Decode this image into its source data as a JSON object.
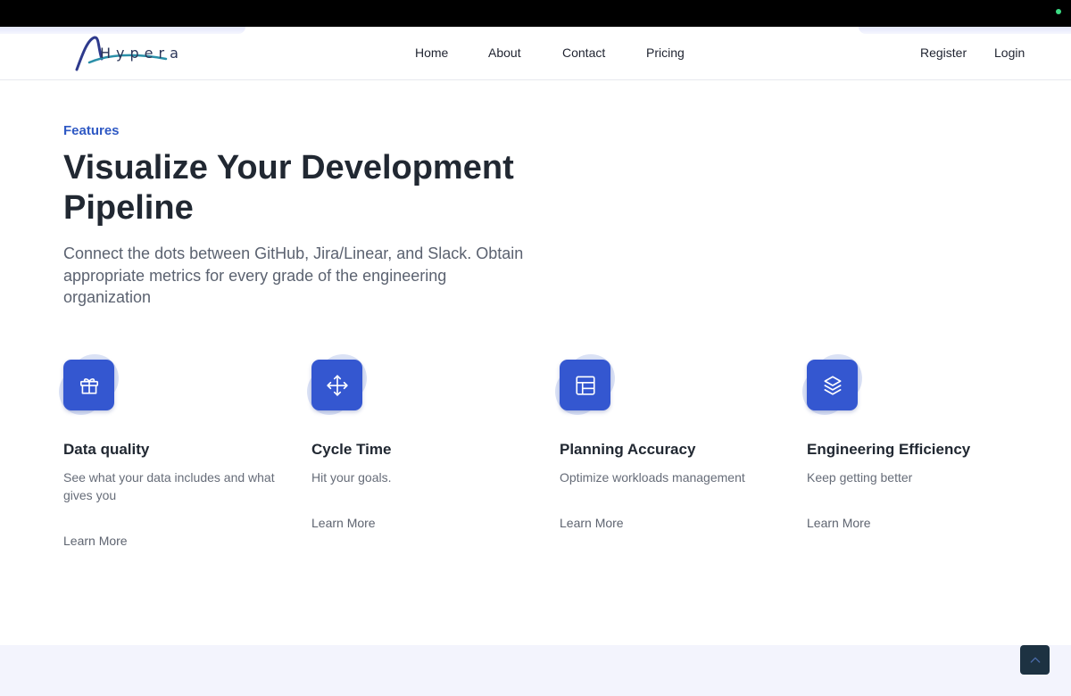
{
  "brand": {
    "name": "Hypera"
  },
  "nav": {
    "links": [
      "Home",
      "About",
      "Contact",
      "Pricing"
    ],
    "register": "Register",
    "login": "Login"
  },
  "hero": {
    "eyebrow": "Features",
    "title": "Visualize Your Development Pipeline",
    "subtitle": "Connect the dots between GitHub, Jira/Linear, and Slack. Obtain appropriate metrics for every grade of the engineering organization"
  },
  "features": [
    {
      "icon": "gift-icon",
      "title": "Data quality",
      "description": "See what your data includes and what gives you",
      "link": "Learn More"
    },
    {
      "icon": "move-arrows-icon",
      "title": "Cycle Time",
      "description": "Hit your goals.",
      "link": "Learn More"
    },
    {
      "icon": "layout-icon",
      "title": "Planning Accuracy",
      "description": "Optimize workloads management",
      "link": "Learn More"
    },
    {
      "icon": "layers-icon",
      "title": "Engineering Efficiency",
      "description": "Keep getting better",
      "link": "Learn More"
    }
  ],
  "colors": {
    "accent": "#3457d0",
    "eyebrow": "#2f59c4",
    "heading": "#212832",
    "footer_band": "#f3f4fd",
    "back_to_top": "#1d3242"
  }
}
